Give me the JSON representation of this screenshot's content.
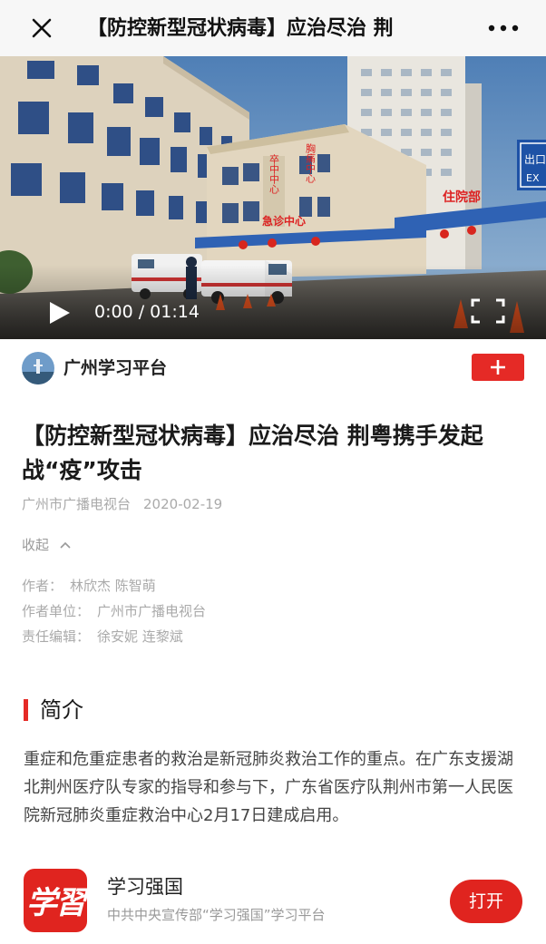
{
  "navbar": {
    "title": "【防控新型冠状病毒】应治尽治 荆",
    "close_icon": "close-icon",
    "more_icon": "more-horizontal-icon"
  },
  "video": {
    "current_time": "0:00",
    "separator": "/",
    "duration": "01:14",
    "play_icon": "play-icon",
    "fullscreen_icon": "fullscreen-icon",
    "sign_main_door": "急诊中心",
    "sign_door_left": "卒中中心",
    "sign_door_right": "胸痛中心",
    "sign_inpatient": "住院部",
    "sign_blue": "出口",
    "sign_blue_sub": "EX"
  },
  "channel": {
    "name": "广州学习平台",
    "follow_icon": "plus-icon"
  },
  "article": {
    "title": "【防控新型冠状病毒】应治尽治 荆粤携手发起战“疫”攻击",
    "source": "广州市广播电视台",
    "date": "2020-02-19",
    "collapse_label": "收起",
    "collapse_icon": "chevron-up-icon",
    "info": [
      {
        "label": "作者：",
        "value": "林欣杰 陈智萌"
      },
      {
        "label": "作者单位：",
        "value": "广州市广播电视台"
      },
      {
        "label": "责任编辑：",
        "value": "徐安妮 连黎斌"
      }
    ],
    "section_title": "简介",
    "summary": "重症和危重症患者的救治是新冠肺炎救治工作的重点。在广东支援湖北荆州医疗队专家的指导和参与下，广东省医疗队荆州市第一人民医院新冠肺炎重症救治中心2月17日建成启用。"
  },
  "app_banner": {
    "logo_text": "学習",
    "name": "学习强国",
    "description": "中共中央宣传部“学习强国”学习平台",
    "open_label": "打开"
  },
  "colors": {
    "accent_red": "#e52a26",
    "navbar_bg": "#f7f7f7",
    "meta_gray": "#aaaaaa"
  }
}
